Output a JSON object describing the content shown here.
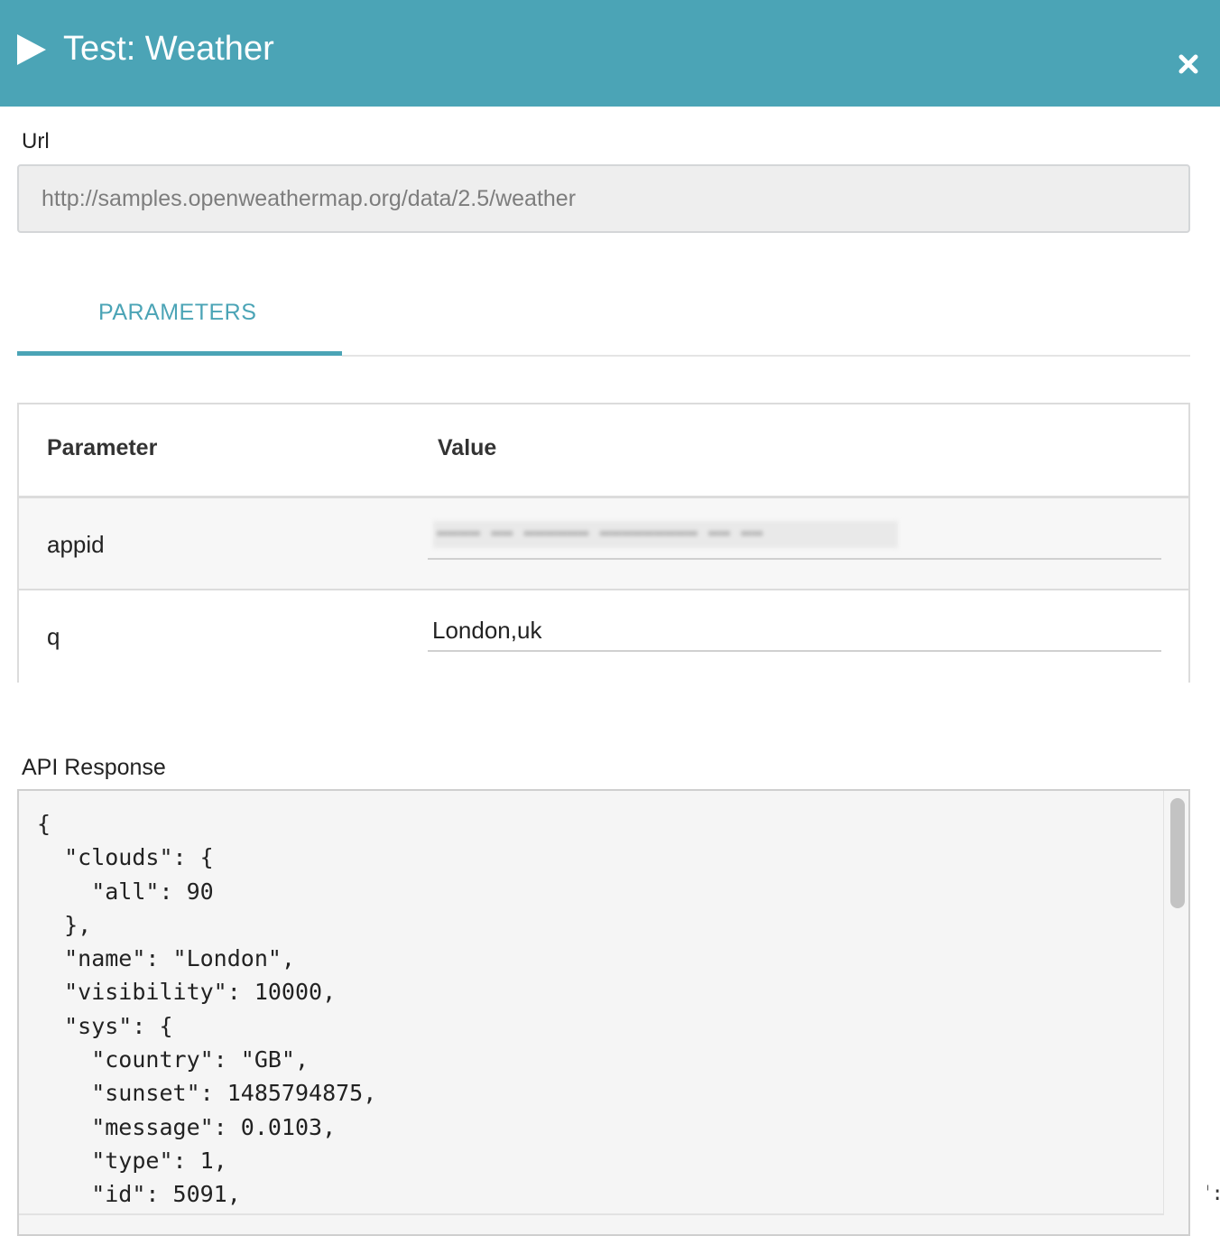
{
  "header": {
    "title": "Test: Weather"
  },
  "url": {
    "label": "Url",
    "value": "http://samples.openweathermap.org/data/2.5/weather"
  },
  "tabs": [
    {
      "label": "PARAMETERS",
      "active": true
    }
  ],
  "parameters": {
    "headers": [
      "Parameter",
      "Value"
    ],
    "rows": [
      {
        "name": "appid",
        "value": "",
        "value_redacted": true
      },
      {
        "name": "q",
        "value": "London,uk"
      }
    ]
  },
  "api_response": {
    "label": "API Response",
    "body": "{\n  \"clouds\": {\n    \"all\": 90\n  },\n  \"name\": \"London\",\n  \"visibility\": 10000,\n  \"sys\": {\n    \"country\": \"GB\",\n    \"sunset\": 1485794875,\n    \"message\": 0.0103,\n    \"type\": 1,\n    \"id\": 5091,"
  },
  "background_fragment": "\\\":\n\""
}
